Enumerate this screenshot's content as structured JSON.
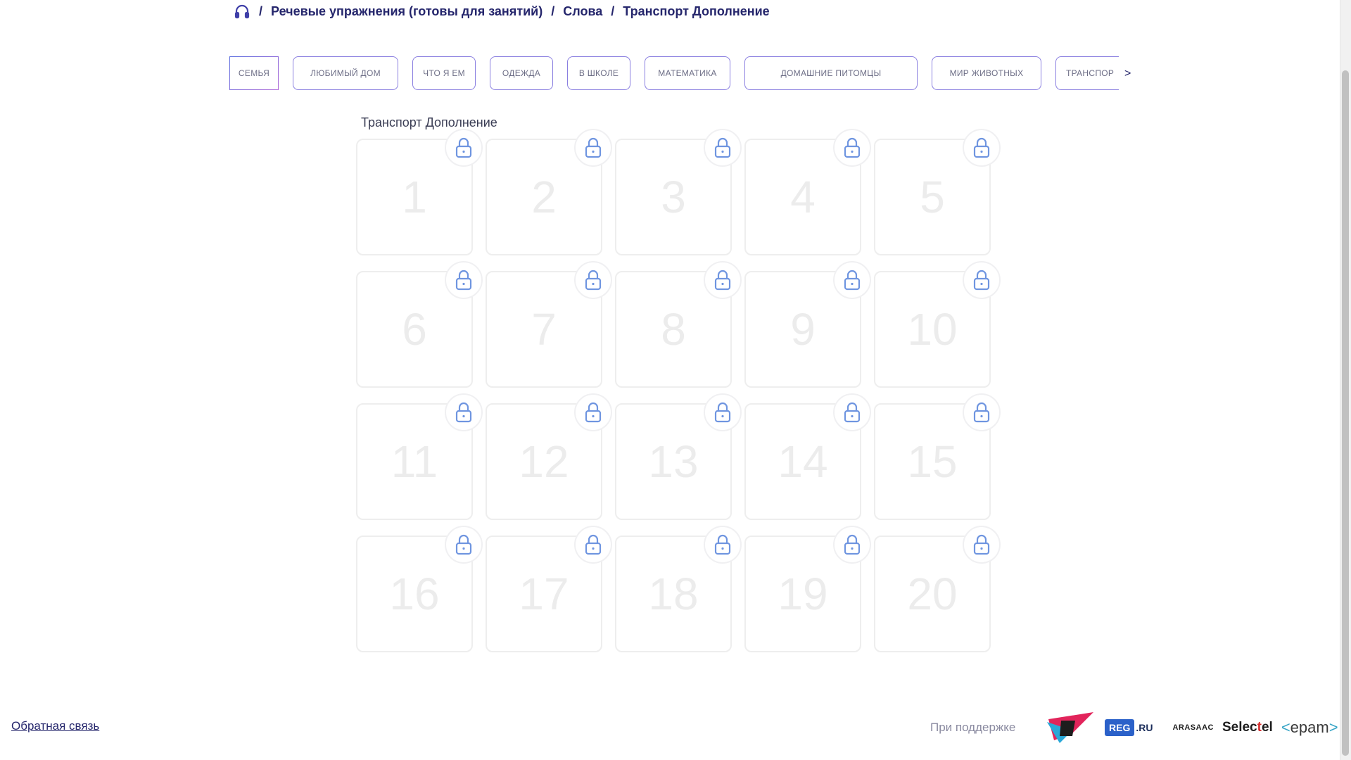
{
  "breadcrumb": {
    "home_icon": "headphones-icon",
    "separator": "/",
    "items": [
      "Речевые упражнения (готовы для занятий)",
      "Слова",
      "Транспорт Дополнение"
    ]
  },
  "tabs": [
    {
      "label": "СЕМЬЯ"
    },
    {
      "label": "ЛЮБИМЫЙ ДОМ"
    },
    {
      "label": "ЧТО Я ЕМ"
    },
    {
      "label": "ОДЕЖДА"
    },
    {
      "label": "В ШКОЛЕ"
    },
    {
      "label": "МАТЕМАТИКА"
    },
    {
      "label": "ДОМАШНИЕ ПИТОМЦЫ"
    },
    {
      "label": "МИР ЖИВОТНЫХ"
    },
    {
      "label": "ТРАНСПОР"
    }
  ],
  "tabs_next": ">",
  "section_title": "Транспорт Дополнение",
  "cards": [
    "1",
    "2",
    "3",
    "4",
    "5",
    "6",
    "7",
    "8",
    "9",
    "10",
    "11",
    "12",
    "13",
    "14",
    "15",
    "16",
    "17",
    "18",
    "19",
    "20"
  ],
  "card_lock_icon": "lock-icon",
  "footer": {
    "feedback": "Обратная связь",
    "support": "При поддержке",
    "sponsors": {
      "reg_a": "REG",
      "reg_b": ".RU",
      "arasaac": "ARASAAC",
      "selectel_a": "Selec",
      "selectel_b": "t",
      "selectel_c": "el",
      "epam_l": "<",
      "epam": "epam",
      "epam_r": ">"
    }
  },
  "colors": {
    "primary": "#25266c",
    "lock": "#6f95e0",
    "card_border": "#eeeeee"
  }
}
